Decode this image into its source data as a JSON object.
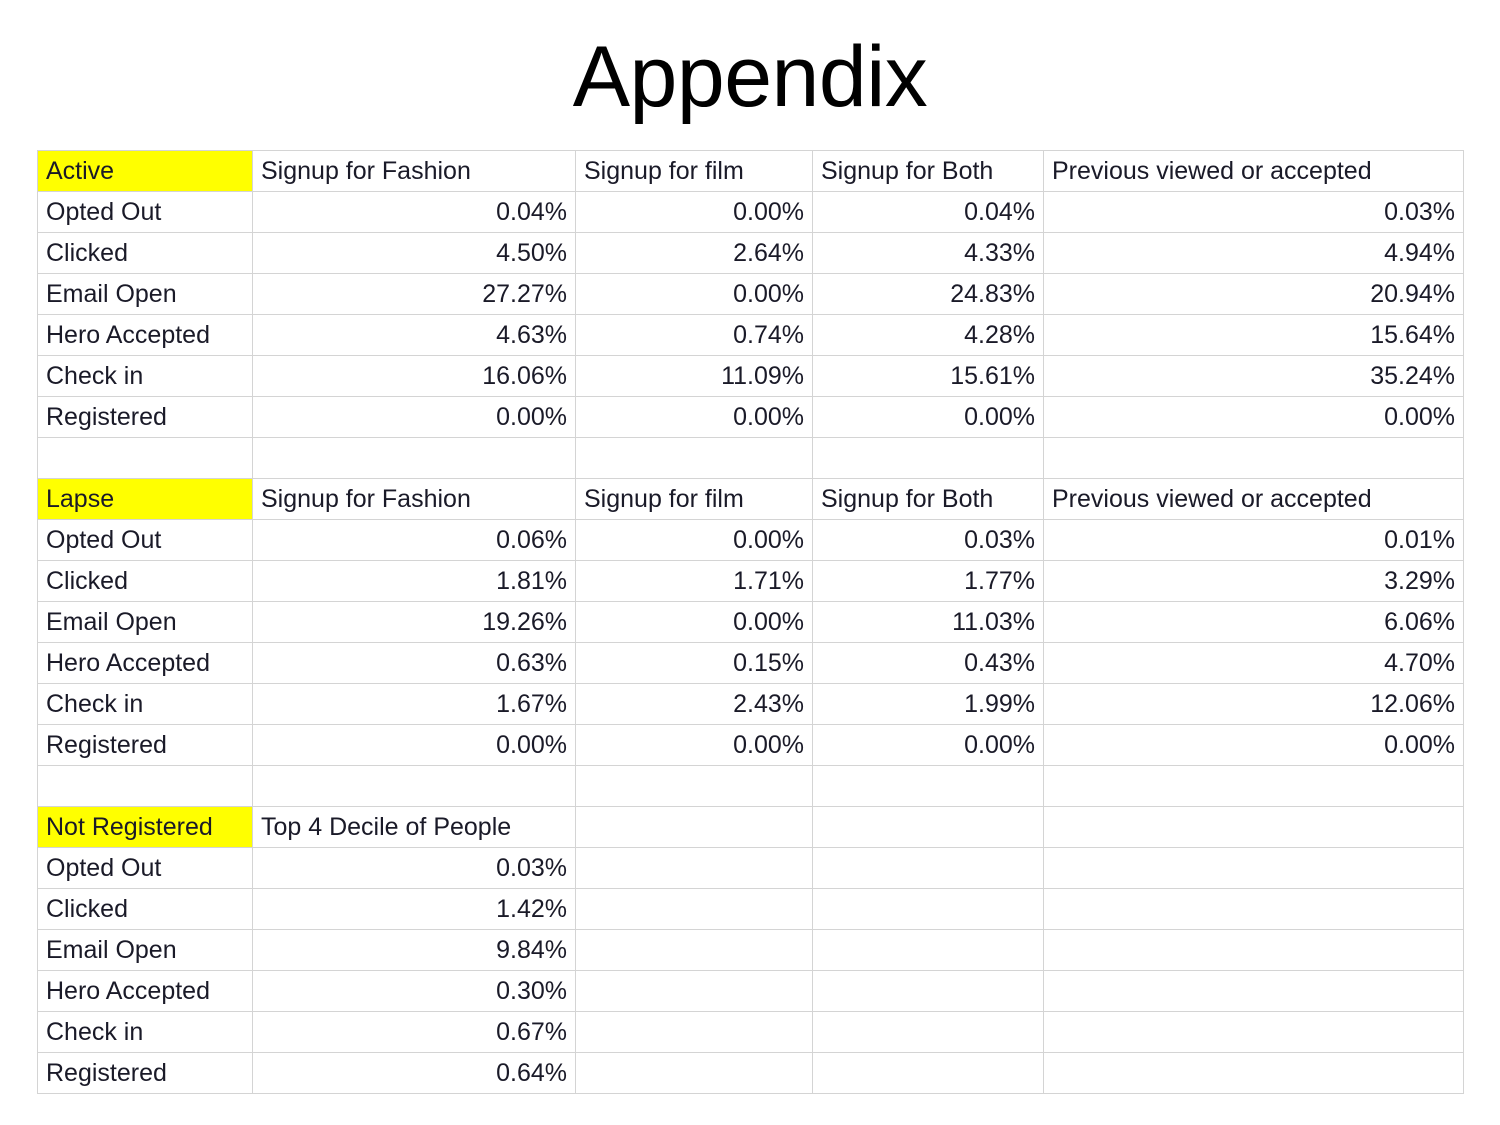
{
  "slide": {
    "title": "Appendix"
  },
  "colors": {
    "highlight": "#ffff00",
    "grid": "#d4d4d4",
    "text": "#1a1a28",
    "background": "#ffffff"
  },
  "chart_data": {
    "type": "table",
    "title": "Appendix",
    "sections": [
      {
        "name": "Active",
        "highlighted": true,
        "columns": [
          "Active",
          "Signup for Fashion",
          "Signup for film",
          "Signup for Both",
          "Previous viewed or accepted"
        ],
        "rows": [
          {
            "label": "Opted Out",
            "values": [
              "0.04%",
              "0.00%",
              "0.04%",
              "0.03%"
            ]
          },
          {
            "label": "Clicked",
            "values": [
              "4.50%",
              "2.64%",
              "4.33%",
              "4.94%"
            ]
          },
          {
            "label": "Email Open",
            "values": [
              "27.27%",
              "0.00%",
              "24.83%",
              "20.94%"
            ]
          },
          {
            "label": "Hero Accepted",
            "values": [
              "4.63%",
              "0.74%",
              "4.28%",
              "15.64%"
            ]
          },
          {
            "label": "Check in",
            "values": [
              "16.06%",
              "11.09%",
              "15.61%",
              "35.24%"
            ]
          },
          {
            "label": "Registered",
            "values": [
              "0.00%",
              "0.00%",
              "0.00%",
              "0.00%"
            ]
          }
        ]
      },
      {
        "name": "Lapse",
        "highlighted": true,
        "columns": [
          "Lapse",
          "Signup for Fashion",
          "Signup for film",
          "Signup for Both",
          "Previous viewed or accepted"
        ],
        "rows": [
          {
            "label": "Opted Out",
            "values": [
              "0.06%",
              "0.00%",
              "0.03%",
              "0.01%"
            ]
          },
          {
            "label": "Clicked",
            "values": [
              "1.81%",
              "1.71%",
              "1.77%",
              "3.29%"
            ]
          },
          {
            "label": "Email Open",
            "values": [
              "19.26%",
              "0.00%",
              "11.03%",
              "6.06%"
            ]
          },
          {
            "label": "Hero Accepted",
            "values": [
              "0.63%",
              "0.15%",
              "0.43%",
              "4.70%"
            ]
          },
          {
            "label": "Check in",
            "values": [
              "1.67%",
              "2.43%",
              "1.99%",
              "12.06%"
            ]
          },
          {
            "label": "Registered",
            "values": [
              "0.00%",
              "0.00%",
              "0.00%",
              "0.00%"
            ]
          }
        ]
      },
      {
        "name": "Not Registered",
        "highlighted": true,
        "columns": [
          "Not Registered",
          "Top 4 Decile of People",
          "",
          "",
          ""
        ],
        "rows": [
          {
            "label": "Opted Out",
            "values": [
              "0.03%",
              "",
              "",
              ""
            ]
          },
          {
            "label": "Clicked",
            "values": [
              "1.42%",
              "",
              "",
              ""
            ]
          },
          {
            "label": "Email Open",
            "values": [
              "9.84%",
              "",
              "",
              ""
            ]
          },
          {
            "label": "Hero Accepted",
            "values": [
              "0.30%",
              "",
              "",
              ""
            ]
          },
          {
            "label": "Check in",
            "values": [
              "0.67%",
              "",
              "",
              ""
            ]
          },
          {
            "label": "Registered",
            "values": [
              "0.64%",
              "",
              "",
              ""
            ]
          }
        ]
      }
    ]
  }
}
